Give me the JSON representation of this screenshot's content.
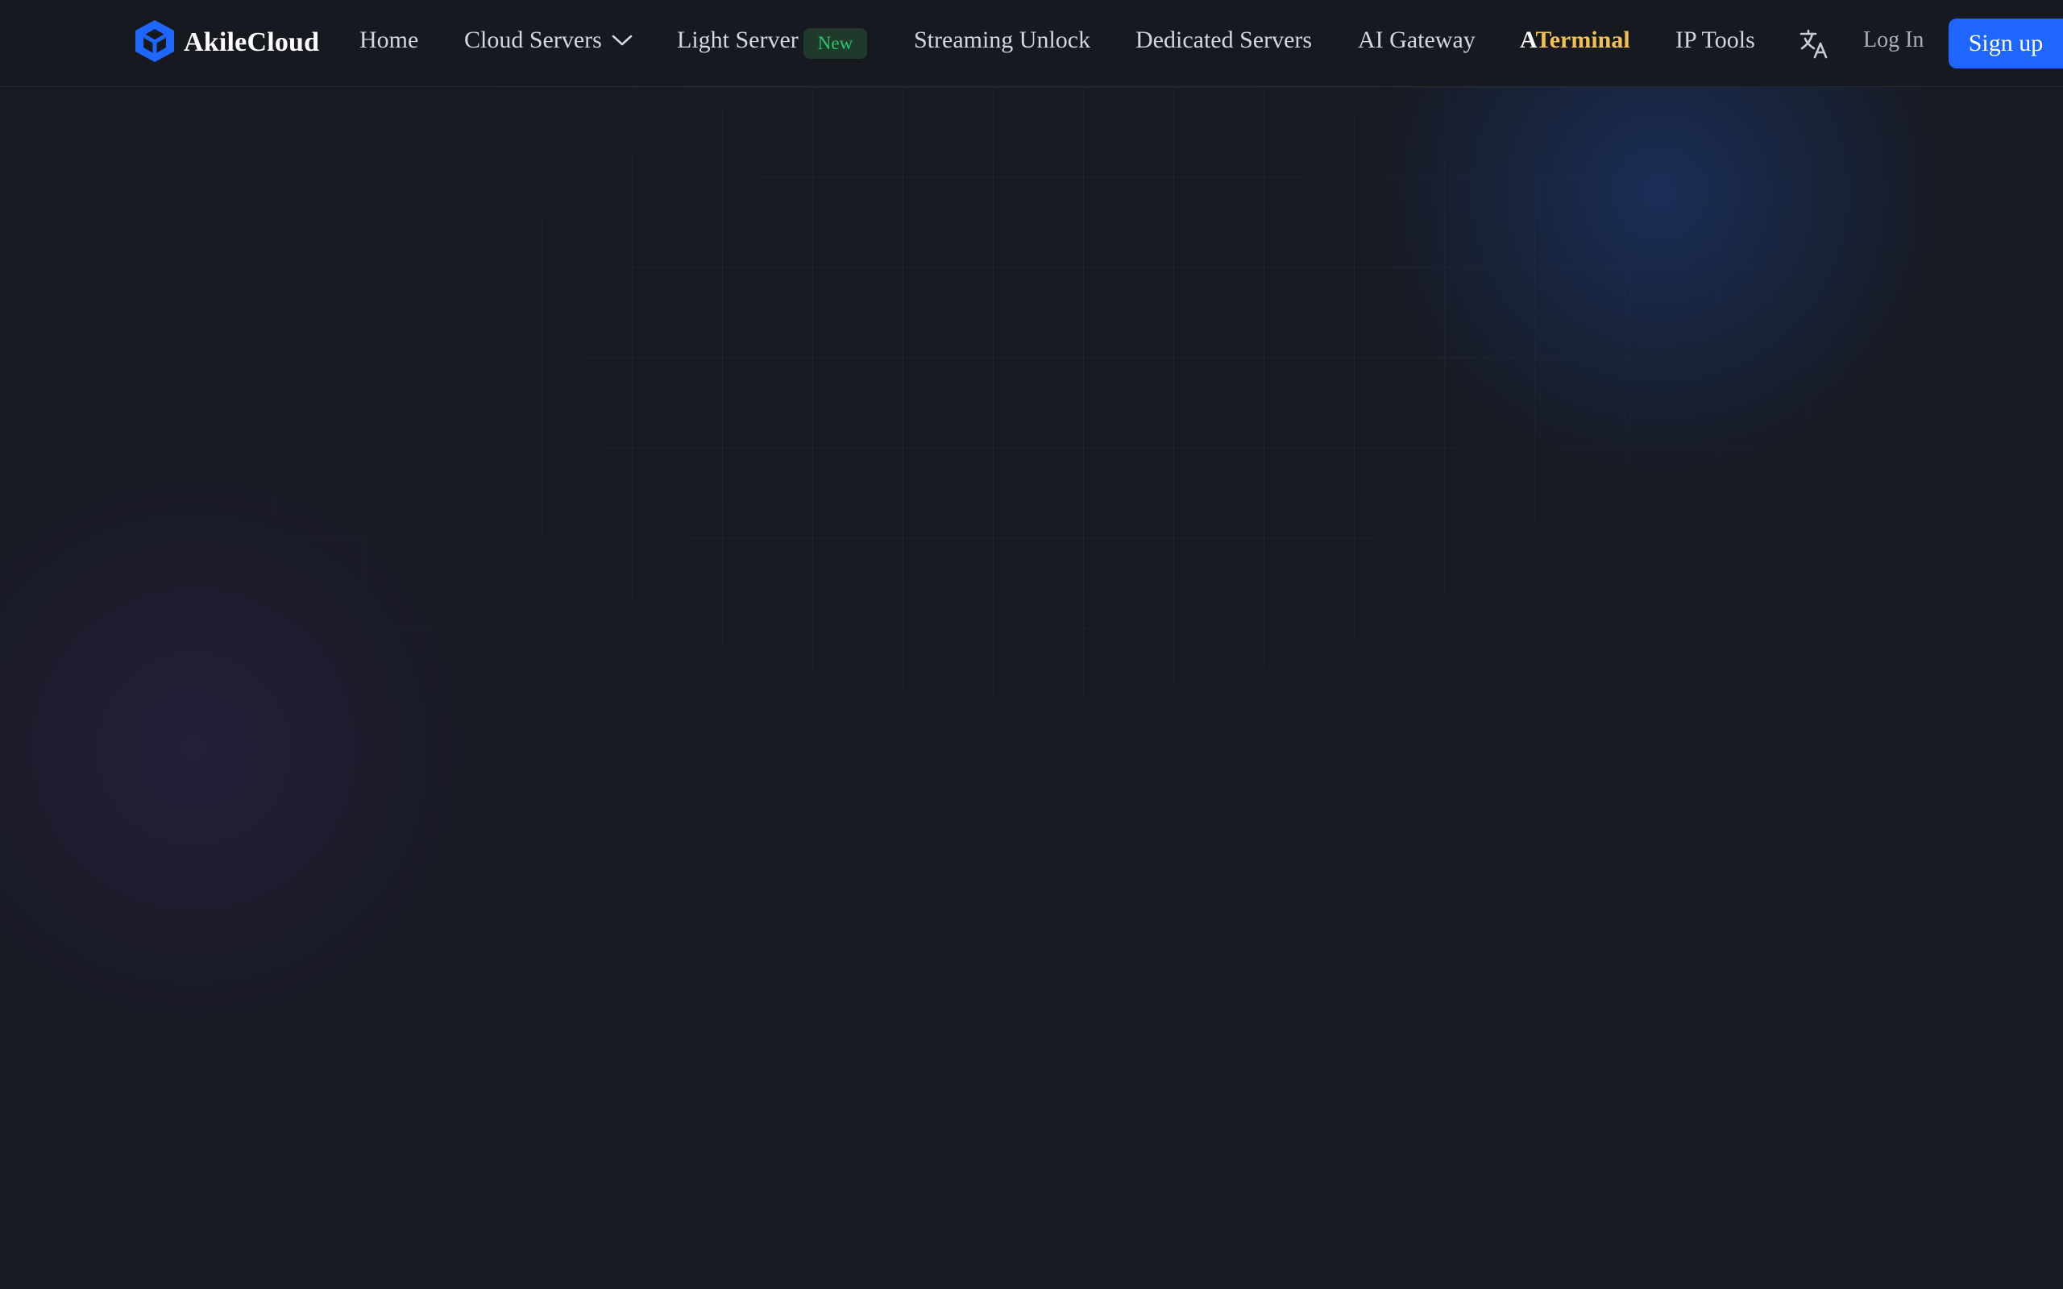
{
  "brand": {
    "name": "AkileCloud",
    "logo_icon": "cube-logo-icon",
    "logo_color": "#1f66ff"
  },
  "nav": {
    "home": "Home",
    "cloud_servers": "Cloud Servers",
    "light_server": "Light Server",
    "light_server_badge": "New",
    "streaming_unlock": "Streaming Unlock",
    "dedicated_servers": "Dedicated Servers",
    "ai_gateway": "AI Gateway",
    "aterminal_a": "A",
    "aterminal_rest": "Terminal",
    "ip_tools": "IP Tools"
  },
  "actions": {
    "translate_icon": "translate-icon",
    "login_label": "Log In",
    "signup_label": "Sign up"
  },
  "colors": {
    "background": "#171a22",
    "navbar": "#16191f",
    "accent": "#1f66ff",
    "badge_bg": "#1f3a2b",
    "badge_text": "#28c76f",
    "aterminal_gold": "#f2c14e"
  }
}
